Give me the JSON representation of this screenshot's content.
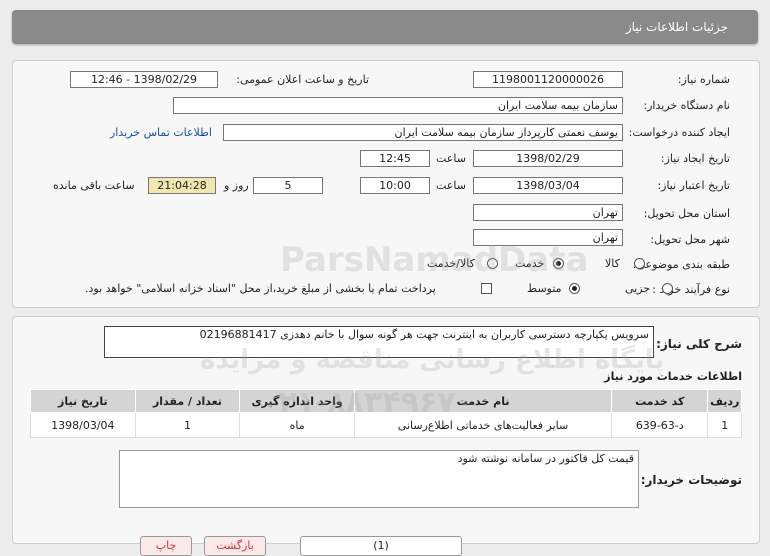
{
  "header": {
    "title": "جزئیات اطلاعات نیاز"
  },
  "form": {
    "need_number_label": "شماره نیاز:",
    "need_number": "1198001120000026",
    "announce_label": "تاریخ و ساعت اعلان عمومی:",
    "announce_value": "1398/02/29 - 12:46",
    "buyer_org_label": "نام دستگاه خریدار:",
    "buyer_org": "سازمان بیمه سلامت ایران",
    "requester_label": "ایجاد کننده درخواست:",
    "requester": "یوسف نعمتی کارپرداز سازمان بیمه سلامت ایران",
    "contact_link": "اطلاعات تماس خریدار",
    "created_label": "تاریخ ایجاد نیاز:",
    "created_date": "1398/02/29",
    "time_label": "ساعت",
    "created_time": "12:45",
    "validity_label": "تاریخ اعتبار نیاز:",
    "validity_date": "1398/03/04",
    "validity_time": "10:00",
    "days": "5",
    "days_label": "روز و",
    "remaining_time": "21:04:28",
    "remaining_label": "ساعت باقی مانده",
    "province_label": "استان محل تحویل:",
    "province": "تهران",
    "city_label": "شهر محل تحویل:",
    "city": "تهران",
    "category_label": "طبقه بندی موضوعی:",
    "category_options": [
      "کالا",
      "خدمت",
      "کالا/خدمت"
    ],
    "category_selected": "خدمت",
    "process_label": "نوع فرآیند خرید :",
    "process_options": [
      "جزیی",
      "متوسط"
    ],
    "process_selected": "متوسط",
    "payment_note": "پرداخت تمام یا بخشی از مبلغ خرید،از محل \"اسناد خزانه اسلامی\" خواهد بود."
  },
  "summary": {
    "label": "شرح کلی نیاز:",
    "text": "سرویس یکپارچه دسترسی کاربران به اینترنت جهت هر گونه سوال با خانم دهدزی 02196881417"
  },
  "services": {
    "title": "اطلاعات خدمات مورد نیاز",
    "columns": [
      "ردیف",
      "کد خدمت",
      "نام خدمت",
      "واحد اندازه گیری",
      "تعداد / مقدار",
      "تاریخ نیاز"
    ],
    "rows": [
      [
        "1",
        "د-63-639",
        "سایر فعالیت‌های خدماتی اطلاع‌رسانی",
        "ماه",
        "1",
        "1398/03/04"
      ]
    ]
  },
  "buyer_notes": {
    "label": "توضیحات خریدار:",
    "text": "قیمت کل فاکتور در سامانه نوشته شود"
  },
  "footer": {
    "buttons": [
      "(1)",
      "بازگشت",
      "چاپ"
    ]
  },
  "watermark": {
    "line1": "ParsNamadData",
    "line2": "پایگاه اطلاع رسانی مناقصه و مزایده",
    "line3": "۰۲۱-۸۸۳۴۹۶۷۰"
  },
  "colors": {
    "header_bg": "#8a8a8a",
    "link": "#1a4fa0",
    "remaining_bg": "#f3e7b0"
  }
}
